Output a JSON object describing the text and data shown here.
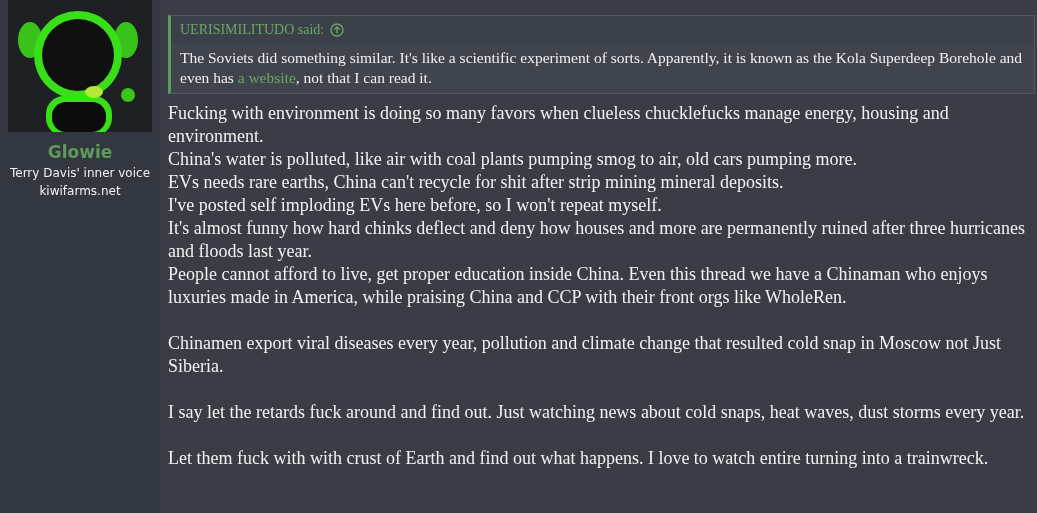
{
  "user": {
    "name": "Glowie",
    "title": "Terry Davis' inner voice",
    "banner": "kiwifarms.net"
  },
  "quote": {
    "author": "UERISIMILITUDO said:",
    "text_before": "The Soviets did something similar. It's like a scientific experiment of sorts. Apparently, it is known as the Kola Superdeep Borehole and even has ",
    "link": "a website",
    "text_after": ", not that I can read it."
  },
  "body": [
    {
      "lines": [
        "Fucking with environment is doing so many favors when clueless chucklefucks manage energy, housing and environment.",
        "China's water is polluted, like air with coal plants pumping smog to air, old cars pumping more.",
        "EVs needs rare earths, China can't recycle for shit after strip mining mineral deposits.",
        "I've posted self imploding EVs here before, so I won't repeat myself.",
        "It's almost funny how hard chinks deflect and deny how houses and more are permanently ruined after three hurricanes and floods last year.",
        "People cannot afford to live, get proper education inside China. Even this thread we have a Chinaman who enjoys luxuries made in America, while praising China and CCP with their front orgs like WholeRen."
      ]
    },
    {
      "lines": [
        "Chinamen export viral diseases every year, pollution and climate change that resulted cold snap in Moscow not Just Siberia."
      ]
    },
    {
      "lines": [
        "I say let the retards fuck around and find out. Just watching news about cold snaps, heat waves, dust storms every year."
      ]
    },
    {
      "lines": [
        "Let them fuck with with crust of Earth and find out what happens. I love to watch entire turning into a trainwreck."
      ]
    }
  ]
}
